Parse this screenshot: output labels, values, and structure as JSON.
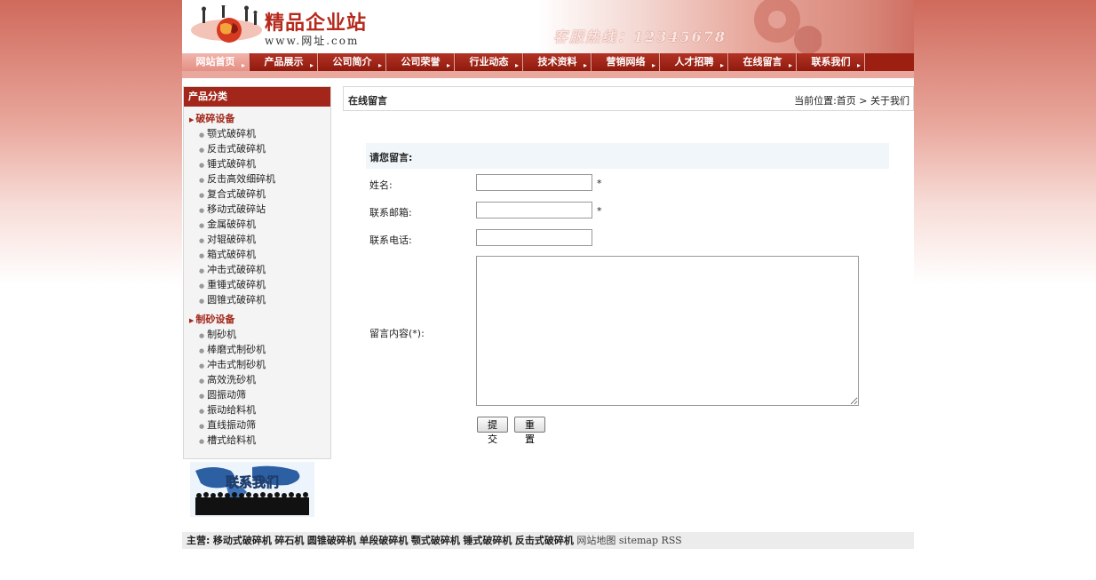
{
  "header": {
    "site_name": "精品企业站",
    "site_url": "www.网址.com",
    "hotline": "客服热线：12345678"
  },
  "nav": [
    {
      "label": "网站首页",
      "active": true
    },
    {
      "label": "产品展示"
    },
    {
      "label": "公司简介"
    },
    {
      "label": "公司荣誉"
    },
    {
      "label": "行业动态"
    },
    {
      "label": "技术资料"
    },
    {
      "label": "营销网络"
    },
    {
      "label": "人才招聘"
    },
    {
      "label": "在线留言"
    },
    {
      "label": "联系我们"
    }
  ],
  "sidebar": {
    "title": "产品分类",
    "categories": [
      {
        "name": "破碎设备",
        "items": [
          "颚式破碎机",
          "反击式破碎机",
          "锤式破碎机",
          "反击高效细碎机",
          "复合式破碎机",
          "移动式破碎站",
          "金属破碎机",
          "对辊破碎机",
          "箱式破碎机",
          "冲击式破碎机",
          "重锤式破碎机",
          "圆锥式破碎机"
        ]
      },
      {
        "name": "制砂设备",
        "items": [
          "制砂机",
          "棒磨式制砂机",
          "冲击式制砂机",
          "高效洗砂机",
          "圆振动筛",
          "振动给料机",
          "直线振动筛",
          "槽式给料机"
        ]
      }
    ],
    "contact_label": "联系我们"
  },
  "main": {
    "title": "在线留言",
    "breadcrumb": "当前位置:首页 > 关于我们"
  },
  "form": {
    "title": "请您留言:",
    "name_label": "姓名:",
    "email_label": "联系邮箱:",
    "phone_label": "联系电话:",
    "message_label": "留言内容(*):",
    "required_mark": "*",
    "submit_label": "提交",
    "reset_label": "重置"
  },
  "footer": {
    "prefix": "主营:",
    "links": [
      "移动式破碎机",
      "碎石机",
      "圆锥破碎机",
      "单段破碎机",
      "颚式破碎机",
      "锤式破碎机",
      "反击式破碎机"
    ],
    "sitemap": "网站地图",
    "sitemap_en": "sitemap",
    "rss": "RSS"
  }
}
